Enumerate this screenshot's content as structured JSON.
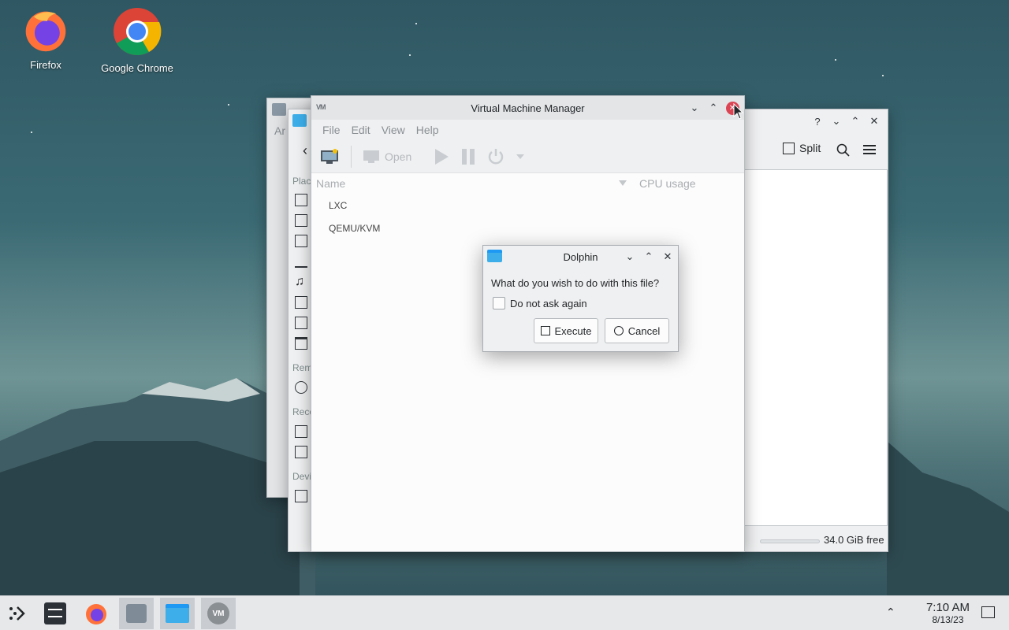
{
  "desktop": {
    "icons": [
      {
        "label": "Firefox"
      },
      {
        "label": "Google Chrome"
      }
    ]
  },
  "dolphin_back": {
    "partial_text": "Ar"
  },
  "dolphin": {
    "toolbar": {
      "split_label": "Split"
    },
    "sidebar_labels": [
      "Plac",
      "Rem",
      "Rece",
      "Devi"
    ],
    "status": {
      "free_space": "34.0 GiB free"
    },
    "title_buttons": [
      "?",
      "minimize",
      "maximize",
      "close"
    ]
  },
  "vmm": {
    "title": "Virtual Machine Manager",
    "menu": [
      "File",
      "Edit",
      "View",
      "Help"
    ],
    "toolbar": {
      "open_label": "Open"
    },
    "columns": {
      "name": "Name",
      "cpu": "CPU usage"
    },
    "rows": [
      "LXC",
      "QEMU/KVM"
    ]
  },
  "dialog": {
    "title": "Dolphin",
    "question": "What do you wish to do with this file?",
    "checkbox_label": "Do not ask again",
    "execute_label": "Execute",
    "cancel_label": "Cancel"
  },
  "taskbar": {
    "time": "7:10 AM",
    "date": "8/13/23"
  },
  "colors": {
    "close_red": "#da4453",
    "panel_bg": "#e6e8ea",
    "window_bg": "#eff0f1"
  }
}
